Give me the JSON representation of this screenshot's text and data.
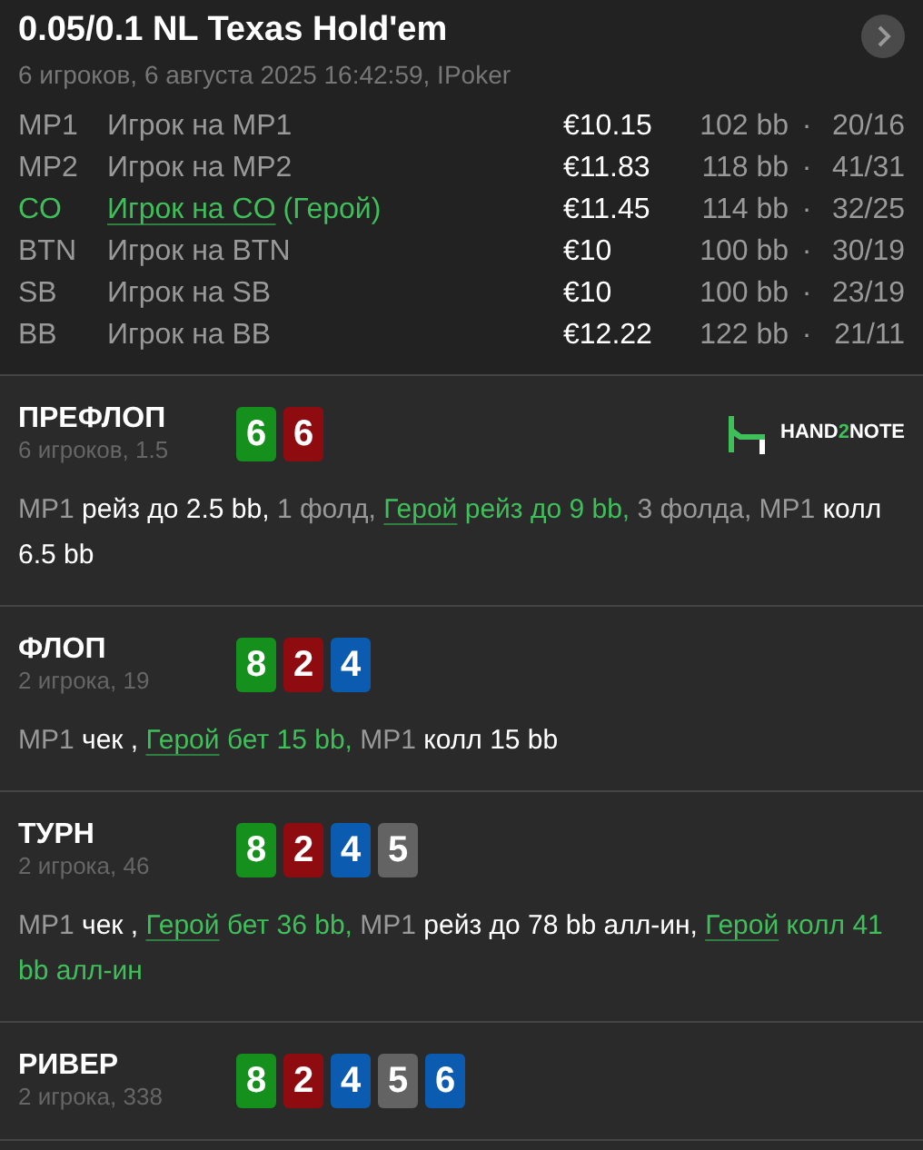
{
  "header": {
    "title": "0.05/0.1 NL Texas Hold'em",
    "subtitle": "6 игроков, 6 августа 2025 16:42:59, IPoker"
  },
  "players": [
    {
      "position": "MP1",
      "name": "Игрок на MP1",
      "hero": false,
      "stack": "€10.15",
      "bb": "102 bb",
      "separator": "·",
      "stats": "20/16"
    },
    {
      "position": "MP2",
      "name": "Игрок на MP2",
      "hero": false,
      "stack": "€11.83",
      "bb": "118 bb",
      "separator": "·",
      "stats": "41/31"
    },
    {
      "position": "CO",
      "name": "Игрок на CO",
      "suffix": "(Герой)",
      "hero": true,
      "stack": "€11.45",
      "bb": "114 bb",
      "separator": "·",
      "stats": "32/25"
    },
    {
      "position": "BTN",
      "name": "Игрок на BTN",
      "hero": false,
      "stack": "€10",
      "bb": "100 bb",
      "separator": "·",
      "stats": "30/19"
    },
    {
      "position": "SB",
      "name": "Игрок на SB",
      "hero": false,
      "stack": "€10",
      "bb": "100 bb",
      "separator": "·",
      "stats": "23/19"
    },
    {
      "position": "BB",
      "name": "Игрок на BB",
      "hero": false,
      "stack": "€12.22",
      "bb": "122 bb",
      "separator": "·",
      "stats": "21/11"
    }
  ],
  "streets": [
    {
      "title": "ПРЕФЛОП",
      "subtitle": "6 игроков, 1.5",
      "cards": [
        {
          "rank": "6",
          "color": "#15901c"
        },
        {
          "rank": "6",
          "color": "#8e0b10"
        }
      ],
      "logo": {
        "text_before": "HAND",
        "accent": "2",
        "text_after": "NOTE"
      },
      "actions": [
        {
          "kind": "player",
          "text": "MP1"
        },
        {
          "kind": "action",
          "text": "рейз до 2.5 bb,"
        },
        {
          "kind": "player",
          "text": "1 фолд,"
        },
        {
          "kind": "hero",
          "name": "Герой",
          "text": "рейз до 9 bb,"
        },
        {
          "kind": "player",
          "text": "3 фолда, MP1"
        },
        {
          "kind": "action",
          "text": "колл 6.5 bb"
        }
      ]
    },
    {
      "title": "ФЛОП",
      "subtitle": "2 игрока, 19",
      "cards": [
        {
          "rank": "8",
          "color": "#15901c"
        },
        {
          "rank": "2",
          "color": "#8e0b10"
        },
        {
          "rank": "4",
          "color": "#0b5cb0"
        }
      ],
      "actions": [
        {
          "kind": "player",
          "text": "MP1"
        },
        {
          "kind": "action",
          "text": "чек ,"
        },
        {
          "kind": "hero",
          "name": "Герой",
          "text": "бет 15 bb,"
        },
        {
          "kind": "player",
          "text": "MP1"
        },
        {
          "kind": "action",
          "text": "колл 15 bb"
        }
      ]
    },
    {
      "title": "ТУРН",
      "subtitle": "2 игрока, 46",
      "cards": [
        {
          "rank": "8",
          "color": "#15901c"
        },
        {
          "rank": "2",
          "color": "#8e0b10"
        },
        {
          "rank": "4",
          "color": "#0b5cb0"
        },
        {
          "rank": "5",
          "color": "#636363"
        }
      ],
      "actions": [
        {
          "kind": "player",
          "text": "MP1"
        },
        {
          "kind": "action",
          "text": "чек ,"
        },
        {
          "kind": "hero",
          "name": "Герой",
          "text": "бет 36 bb,"
        },
        {
          "kind": "player",
          "text": "MP1"
        },
        {
          "kind": "action",
          "text": "рейз до 78 bb алл-ин,"
        },
        {
          "kind": "hero",
          "name": "Герой",
          "text": "колл 41 bb алл-ин"
        }
      ]
    },
    {
      "title": "РИВЕР",
      "subtitle": "2 игрока, 338",
      "cards": [
        {
          "rank": "8",
          "color": "#15901c"
        },
        {
          "rank": "2",
          "color": "#8e0b10"
        },
        {
          "rank": "4",
          "color": "#0b5cb0"
        },
        {
          "rank": "5",
          "color": "#636363"
        },
        {
          "rank": "6",
          "color": "#0b5cb0"
        }
      ]
    }
  ]
}
